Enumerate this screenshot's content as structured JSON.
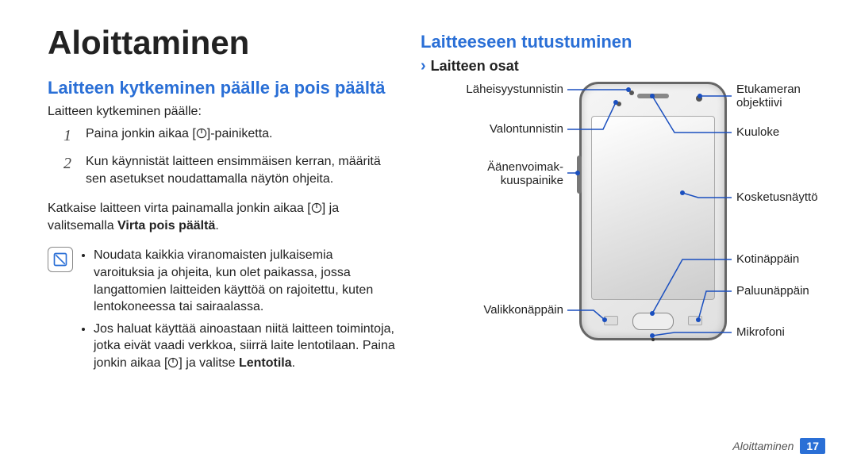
{
  "title": "Aloittaminen",
  "left": {
    "heading": "Laitteen kytkeminen päälle ja pois päältä",
    "lead": "Laitteen kytkeminen päälle:",
    "step1": "Paina jonkin aikaa [",
    "step1_after": "]-painiketta.",
    "step2": "Kun käynnistät laitteen ensimmäisen kerran, määritä sen asetukset noudattamalla näytön ohjeita.",
    "shutdown_a": "Katkaise laitteen virta painamalla jonkin aikaa [",
    "shutdown_b": "] ja valitsemalla ",
    "shutdown_bold": "Virta pois päältä",
    "note1": "Noudata kaikkia viranomaisten julkaisemia varoituksia ja ohjeita, kun olet paikassa, jossa langattomien laitteiden käyttöä on rajoitettu, kuten lentokoneessa tai sairaalassa.",
    "note2_a": "Jos haluat käyttää ainoastaan niitä laitteen toimintoja, jotka eivät vaadi verkkoa, siirrä laite lentotilaan. Paina jonkin aikaa [",
    "note2_b": "] ja valitse ",
    "note2_bold": "Lentotila"
  },
  "right": {
    "heading": "Laitteeseen tutustuminen",
    "subheading": "Laitteen osat",
    "labels": {
      "proximity": "Läheisyystunnistin",
      "light": "Valontunnistin",
      "volume": "Äänenvoimak-\nkuuspainike",
      "menu": "Valikkonäppäin",
      "frontcam": "Etukameran objektiivi",
      "earpiece": "Kuuloke",
      "touchscreen": "Kosketusnäyttö",
      "home": "Kotinäppäin",
      "back": "Paluunäppäin",
      "mic": "Mikrofoni"
    }
  },
  "footer": {
    "section": "Aloittaminen",
    "page": "17"
  }
}
